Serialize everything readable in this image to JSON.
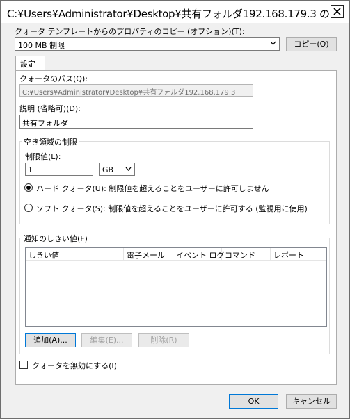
{
  "window": {
    "title": "C:¥Users¥Administrator¥Desktop¥共有フォルダ192.168.179.3 の...",
    "close_glyph": "close"
  },
  "template": {
    "label": "クォータ テンプレートからのプロパティのコピー (オプション)(T):",
    "selected": "100 MB 制限",
    "copy_button": "コピー(O)"
  },
  "tabs": [
    {
      "label": "設定"
    }
  ],
  "settings": {
    "path_label": "クォータのパス(Q):",
    "path_value": "C:¥Users¥Administrator¥Desktop¥共有フォルダ192.168.179.3",
    "desc_label": "説明 (省略可)(D):",
    "desc_value": "共有フォルダ",
    "space_group": "空き領域の制限",
    "limit_label": "制限値(L):",
    "limit_value": "1",
    "unit_value": "GB",
    "hard_label": "ハード クォータ(U): 制限値を超えることをユーザーに許可しません",
    "soft_label": "ソフト クォータ(S): 制限値を超えることをユーザーに許可する (監視用に使用)",
    "quota_type": "hard"
  },
  "notify": {
    "group_label": "通知のしきい値(F)",
    "columns": [
      "しきい値",
      "電子メール",
      "イベント ログ",
      "コマンド",
      "レポート"
    ],
    "rows": [],
    "add_button": "追加(A)...",
    "edit_button": "編集(E)...",
    "delete_button": "削除(R)"
  },
  "disable_quota": {
    "label": "クォータを無効にする(I)",
    "checked": false
  },
  "footer": {
    "ok": "OK",
    "cancel": "キャンセル"
  }
}
